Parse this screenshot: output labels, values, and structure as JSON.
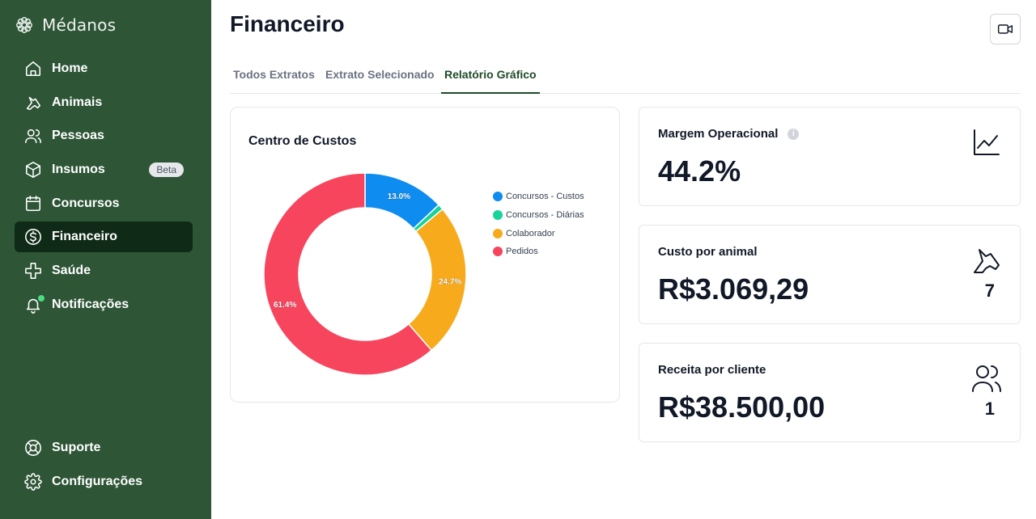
{
  "app": {
    "brand": "Médanos"
  },
  "sidebar": {
    "items": [
      {
        "label": "Home",
        "icon": "home-icon"
      },
      {
        "label": "Animais",
        "icon": "horse-icon"
      },
      {
        "label": "Pessoas",
        "icon": "users-icon"
      },
      {
        "label": "Insumos",
        "icon": "box-icon",
        "badge": "Beta"
      },
      {
        "label": "Concursos",
        "icon": "calendar-icon"
      },
      {
        "label": "Financeiro",
        "icon": "dollar-icon",
        "active": true
      },
      {
        "label": "Saúde",
        "icon": "health-cross-icon"
      },
      {
        "label": "Notificações",
        "icon": "bell-icon"
      }
    ],
    "bottom": [
      {
        "label": "Suporte",
        "icon": "lifebuoy-icon"
      },
      {
        "label": "Configurações",
        "icon": "gear-icon"
      }
    ]
  },
  "header": {
    "title": "Financeiro"
  },
  "tabs": [
    {
      "label": "Todos Extratos"
    },
    {
      "label": "Extrato Selecionado"
    },
    {
      "label": "Relatório Gráfico",
      "active": true
    }
  ],
  "chart_data": {
    "type": "pie",
    "title": "Centro de Custos",
    "donut": true,
    "legend_position": "right",
    "categories": [
      "Concursos - Custos",
      "Concursos - Diárias",
      "Colaborador",
      "Pedidos"
    ],
    "values": [
      13.0,
      0.9,
      24.7,
      61.4
    ],
    "labels": [
      "13.0%",
      "",
      "24.7%",
      "61.4%"
    ],
    "colors": [
      "#0f8cf0",
      "#16d39a",
      "#f7ab1c",
      "#f7455e"
    ]
  },
  "stats": [
    {
      "label": "Margem Operacional",
      "value": "44.2%",
      "icon": "trend-chart-icon",
      "has_info": true
    },
    {
      "label": "Custo por animal",
      "value": "R$3.069,29",
      "icon": "horse-icon",
      "count": "7"
    },
    {
      "label": "Receita por cliente",
      "value": "R$38.500,00",
      "icon": "users-icon",
      "count": "1"
    }
  ]
}
